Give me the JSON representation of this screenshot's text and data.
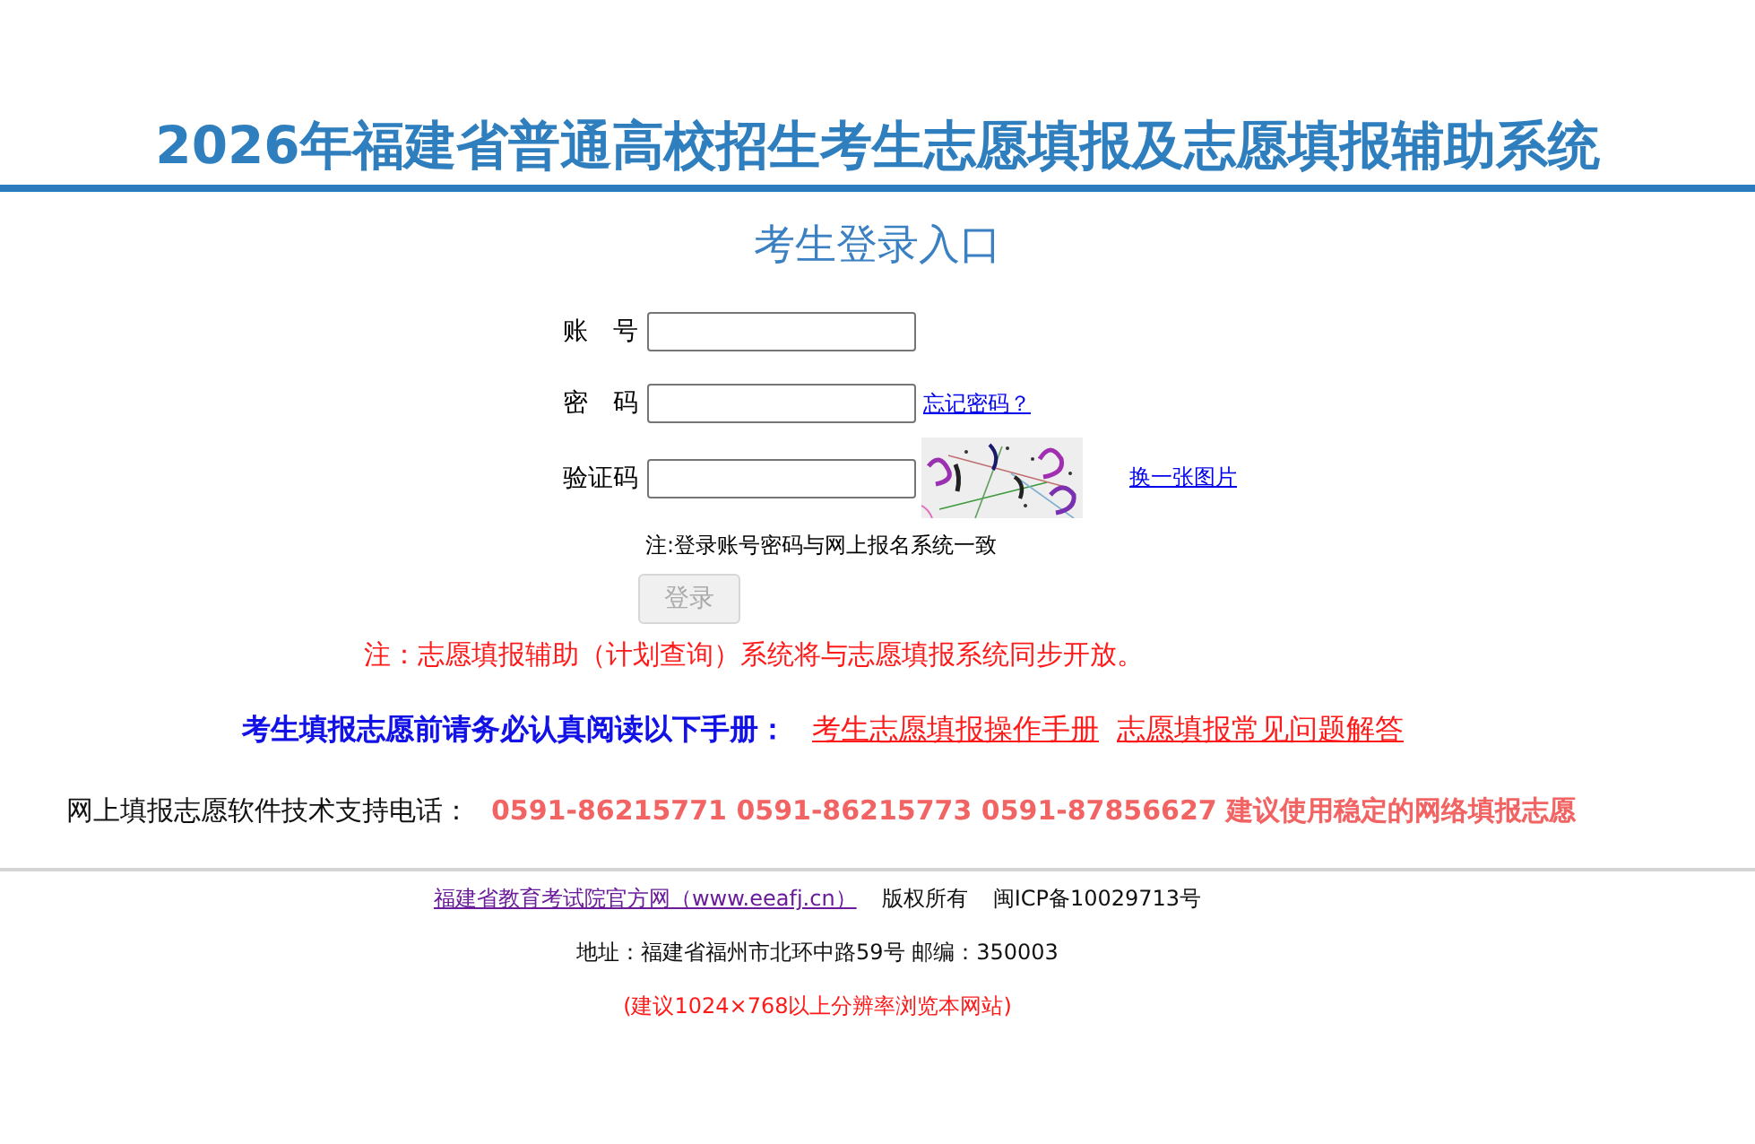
{
  "header": {
    "title": "2026年福建省普通高校招生考生志愿填报及志愿填报辅助系统"
  },
  "login": {
    "title": "考生登录入口",
    "fields": [
      {
        "kind": "text",
        "label": "账　号"
      },
      {
        "kind": "password",
        "label": "密　码",
        "link": "忘记密码？"
      },
      {
        "kind": "captcha",
        "label": "验证码",
        "link": "换一张图片"
      }
    ],
    "note": "注:登录账号密码与网上报名系统一致",
    "submit": {
      "label": "登录",
      "disabled": true
    }
  },
  "notice": "注：志愿填报辅助（计划查询）系统将与志愿填报系统同步开放。",
  "manuals": {
    "prompt": "考生填报志愿前请务必认真阅读以下手册：",
    "links": [
      "考生志愿填报操作手册",
      "志愿填报常见问题解答"
    ]
  },
  "support": {
    "label": "网上填报志愿软件技术支持电话：",
    "phones": "0591-86215771 0591-86215773 0591-87856627 建议使用稳定的网络填报志愿"
  },
  "footer": {
    "site_link": "福建省教育考试院官方网（www.eeafj.cn）",
    "copyright": "版权所有",
    "icp": "闽ICP备10029713号",
    "address": "地址：福建省福州市北环中路59号 邮编：350003",
    "advice": "(建议1024×768以上分辨率浏览本网站)"
  }
}
